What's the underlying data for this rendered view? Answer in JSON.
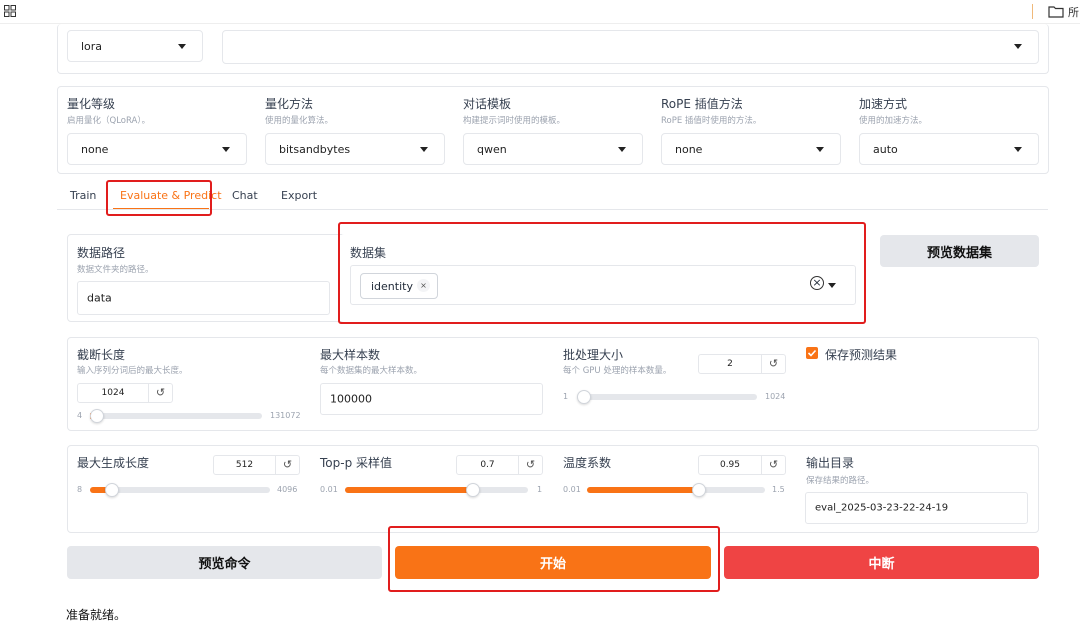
{
  "topbar": {
    "folder_label": "所"
  },
  "top_row": {
    "method_select": "lora",
    "adapter_select": ""
  },
  "options": [
    {
      "label": "量化等级",
      "desc": "启用量化（QLoRA）。",
      "value": "none"
    },
    {
      "label": "量化方法",
      "desc": "使用的量化算法。",
      "value": "bitsandbytes"
    },
    {
      "label": "对话模板",
      "desc": "构建提示词时使用的模板。",
      "value": "qwen"
    },
    {
      "label": "RoPE 插值方法",
      "desc": "RoPE 插值时使用的方法。",
      "value": "none"
    },
    {
      "label": "加速方式",
      "desc": "使用的加速方法。",
      "value": "auto"
    }
  ],
  "tabs": [
    {
      "label": "Train",
      "active": false
    },
    {
      "label": "Evaluate & Predict",
      "active": true
    },
    {
      "label": "Chat",
      "active": false
    },
    {
      "label": "Export",
      "active": false
    }
  ],
  "dataset": {
    "dir_label": "数据路径",
    "dir_desc": "数据文件夹的路径。",
    "dir_value": "data",
    "set_label": "数据集",
    "chips": [
      "identity"
    ],
    "preview_button": "预览数据集"
  },
  "params1": {
    "cutoff": {
      "label": "截断长度",
      "desc": "输入序列分词后的最大长度。",
      "value": "1024",
      "min": "4",
      "max": "131072",
      "fraction": 0.008
    },
    "max_samples": {
      "label": "最大样本数",
      "desc": "每个数据集的最大样本数。",
      "value": "100000"
    },
    "batch": {
      "label": "批处理大小",
      "desc": "每个 GPU 处理的样本数量。",
      "value": "2",
      "min": "1",
      "max": "1024",
      "fraction": 0.001
    },
    "save_predict": {
      "label": "保存预测结果",
      "checked": true
    }
  },
  "params2": {
    "max_new_tokens": {
      "label": "最大生成长度",
      "value": "512",
      "min": "8",
      "max": "4096",
      "fraction": 0.123
    },
    "top_p": {
      "label": "Top-p 采样值",
      "value": "0.7",
      "min": "0.01",
      "max": "1",
      "fraction": 0.697
    },
    "temperature": {
      "label": "温度系数",
      "value": "0.95",
      "min": "0.01",
      "max": "1.5",
      "fraction": 0.631
    },
    "output_dir": {
      "label": "输出目录",
      "desc": "保存结果的路径。",
      "value": "eval_2025-03-23-22-24-19"
    }
  },
  "actions": {
    "preview_cmd": "预览命令",
    "start": "开始",
    "abort": "中断"
  },
  "status_text": "准备就绪。",
  "colors": {
    "accent": "#f97316",
    "abort": "#ef4444",
    "highlight": "#e11d1d"
  },
  "icons": {
    "reset": "↺",
    "clear": "×"
  }
}
